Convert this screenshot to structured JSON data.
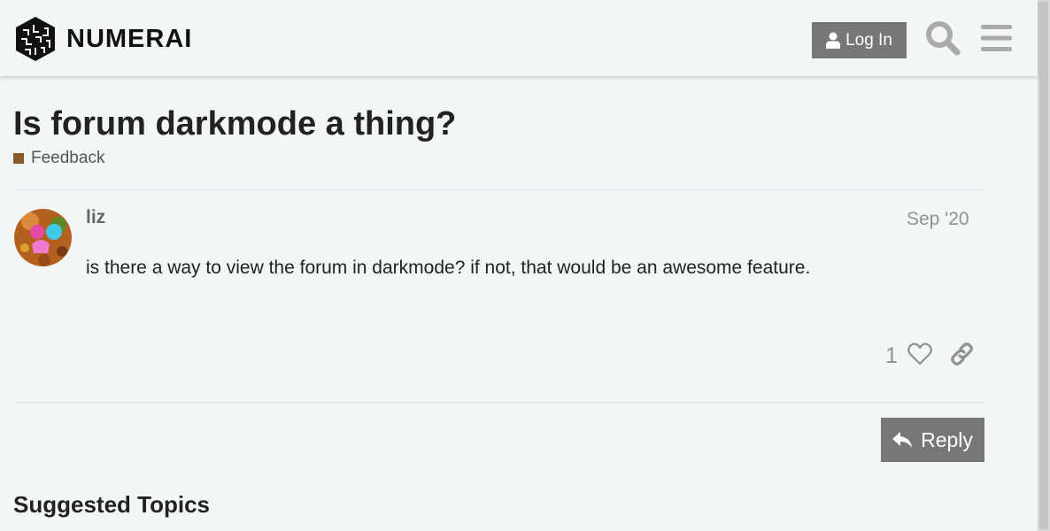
{
  "header": {
    "logo_text": "NUMERAI",
    "login_label": "Log In"
  },
  "topic": {
    "title": "Is forum darkmode a thing?",
    "category": "Feedback",
    "category_color": "#8a5a2b"
  },
  "post": {
    "username": "liz",
    "date": "Sep '20",
    "body": "is there a way to view the forum in darkmode? if not, that would be an awesome feature.",
    "like_count": "1"
  },
  "actions": {
    "reply_label": "Reply"
  },
  "suggested": {
    "heading": "Suggested Topics"
  },
  "icons": [
    "numerai-logo-icon",
    "user-icon",
    "search-icon",
    "hamburger-menu-icon",
    "heart-icon",
    "link-icon",
    "reply-icon"
  ],
  "colors": {
    "background": "#f3f6f7",
    "button": "#777777",
    "muted": "#919191"
  }
}
